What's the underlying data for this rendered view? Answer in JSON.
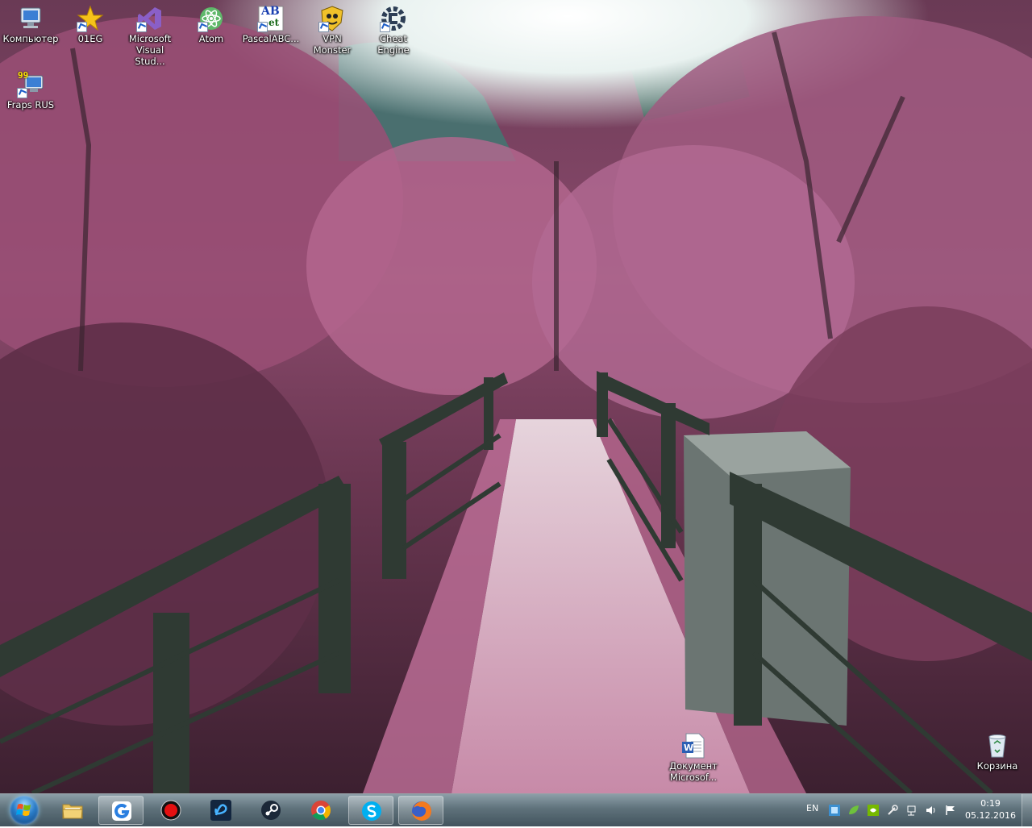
{
  "desktop": {
    "icons": [
      {
        "id": "computer",
        "label": "Компьютер",
        "icon": "computer-icon"
      },
      {
        "id": "01eg",
        "label": "01EG",
        "icon": "star-icon"
      },
      {
        "id": "vs",
        "label": "Microsoft Visual Stud...",
        "icon": "visual-studio-icon"
      },
      {
        "id": "atom",
        "label": "Atom",
        "icon": "atom-icon"
      },
      {
        "id": "pascal",
        "label": "PascalABC...",
        "icon": "pascal-icon"
      },
      {
        "id": "vpn",
        "label": "VPN Monster",
        "icon": "vpn-icon"
      },
      {
        "id": "cheat",
        "label": "Cheat Engine",
        "icon": "cheat-engine-icon"
      },
      {
        "id": "fraps",
        "label": "Fraps RUS",
        "icon": "fraps-icon"
      },
      {
        "id": "doc",
        "label": "Документ Microsof...",
        "icon": "word-document-icon"
      },
      {
        "id": "recycle",
        "label": "Корзина",
        "icon": "recycle-bin-icon"
      }
    ],
    "fraps_badge": "99",
    "pascal_glyph": "AB",
    "pascal_glyph2": "et",
    "word_glyph": "W"
  },
  "taskbar": {
    "start_icon": "windows-orb-icon",
    "apps": [
      {
        "id": "explorer",
        "icon": "folder-icon"
      },
      {
        "id": "app-g",
        "icon": "g-app-icon"
      },
      {
        "id": "recorder",
        "icon": "record-icon"
      },
      {
        "id": "battlenet",
        "icon": "battlenet-icon"
      },
      {
        "id": "steam",
        "icon": "steam-icon"
      },
      {
        "id": "chrome",
        "icon": "chrome-icon"
      },
      {
        "id": "skype",
        "icon": "skype-icon"
      },
      {
        "id": "firefox",
        "icon": "firefox-icon"
      }
    ],
    "tray": {
      "language": "EN",
      "time": "0:19",
      "date": "05.12.2016"
    }
  },
  "colors": {
    "blossom": "#b05a86",
    "railing": "#2f3a33",
    "taskbar": "#5a6e78"
  }
}
